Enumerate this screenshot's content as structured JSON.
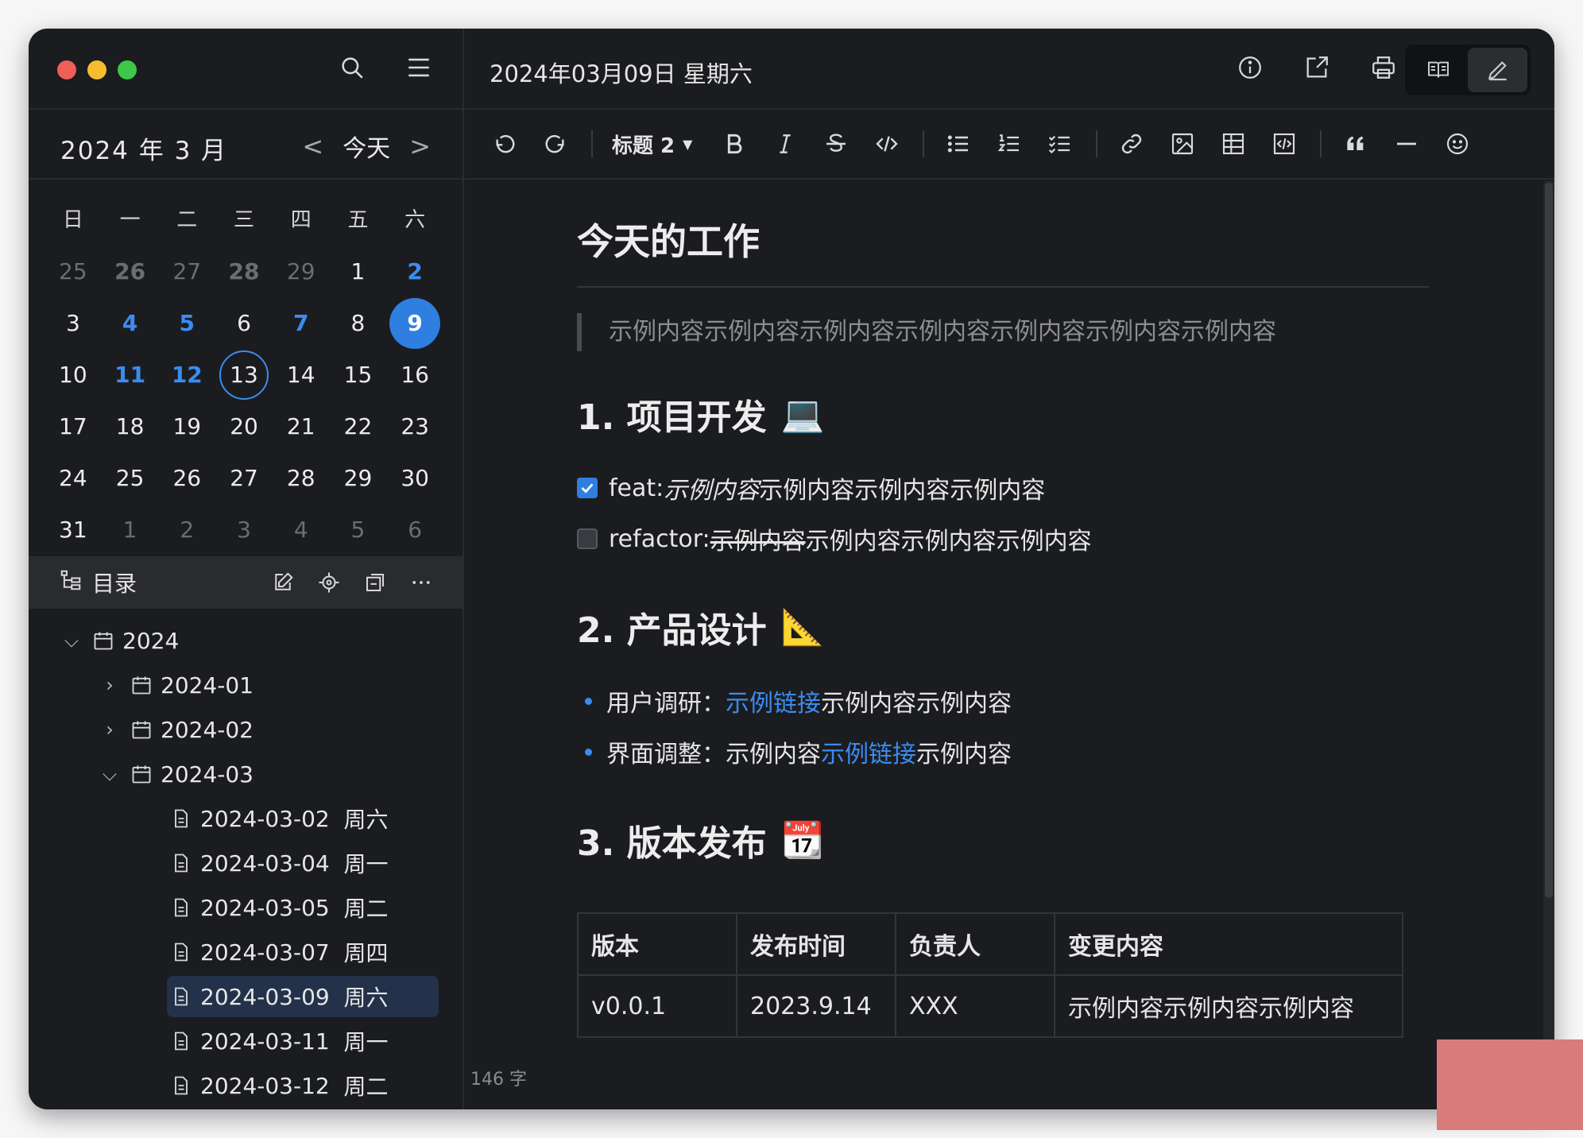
{
  "window": {
    "traffic": [
      "close",
      "minimize",
      "zoom"
    ]
  },
  "sidebar": {
    "calendar": {
      "title": "2024 年 3 月",
      "prev": "<",
      "today_label": "今天",
      "next": ">",
      "weekdays": [
        "日",
        "一",
        "二",
        "三",
        "四",
        "五",
        "六"
      ],
      "weeks": [
        [
          "25",
          "26",
          "27",
          "28",
          "29",
          "1",
          "2"
        ],
        [
          "3",
          "4",
          "5",
          "6",
          "7",
          "8",
          "9"
        ],
        [
          "10",
          "11",
          "12",
          "13",
          "14",
          "15",
          "16"
        ],
        [
          "17",
          "18",
          "19",
          "20",
          "21",
          "22",
          "23"
        ],
        [
          "24",
          "25",
          "26",
          "27",
          "28",
          "29",
          "30"
        ],
        [
          "31",
          "1",
          "2",
          "3",
          "4",
          "5",
          "6"
        ]
      ]
    },
    "toc": {
      "label": "目录"
    },
    "tree": {
      "root": "2024",
      "m1": "2024-01",
      "m2": "2024-02",
      "m3": "2024-03",
      "files": [
        {
          "date": "2024-03-02",
          "day": "周六"
        },
        {
          "date": "2024-03-04",
          "day": "周一"
        },
        {
          "date": "2024-03-05",
          "day": "周二"
        },
        {
          "date": "2024-03-07",
          "day": "周四"
        },
        {
          "date": "2024-03-09",
          "day": "周六"
        },
        {
          "date": "2024-03-11",
          "day": "周一"
        },
        {
          "date": "2024-03-12",
          "day": "周二"
        }
      ]
    }
  },
  "header": {
    "title": "2024年03月09日 星期六"
  },
  "toolbar": {
    "heading": "标题 2"
  },
  "doc": {
    "h1": "今天的工作",
    "quote": "示例内容示例内容示例内容示例内容示例内容示例内容示例内容",
    "s1": {
      "title": "1. 项目开发",
      "emoji": "💻"
    },
    "task1": {
      "prefix": "feat: ",
      "italic": "示例内容",
      "rest": "示例内容示例内容示例内容"
    },
    "task2": {
      "prefix": "refactor: ",
      "strike": "示例内容",
      "rest": "示例内容示例内容示例内容"
    },
    "s2": {
      "title": "2. 产品设计",
      "emoji": "📐"
    },
    "b1": {
      "label": "用户调研：",
      "link": "示例链接",
      "rest": "示例内容示例内容"
    },
    "b2": {
      "label": "界面调整：",
      "pre": "示例内容",
      "link": "示例链接",
      "rest": "示例内容"
    },
    "s3": {
      "title": "3. 版本发布",
      "emoji": "📆"
    },
    "table": {
      "headers": [
        "版本",
        "发布时间",
        "负责人",
        "变更内容"
      ],
      "row": [
        "v0.0.1",
        "2023.9.14",
        "XXX",
        "示例内容示例内容示例内容"
      ]
    }
  },
  "status": {
    "word_count": "146 字"
  },
  "colors": {
    "accent": "#3b8cf0",
    "bg": "#1b1c1f",
    "panel": "#2a2b2f"
  }
}
